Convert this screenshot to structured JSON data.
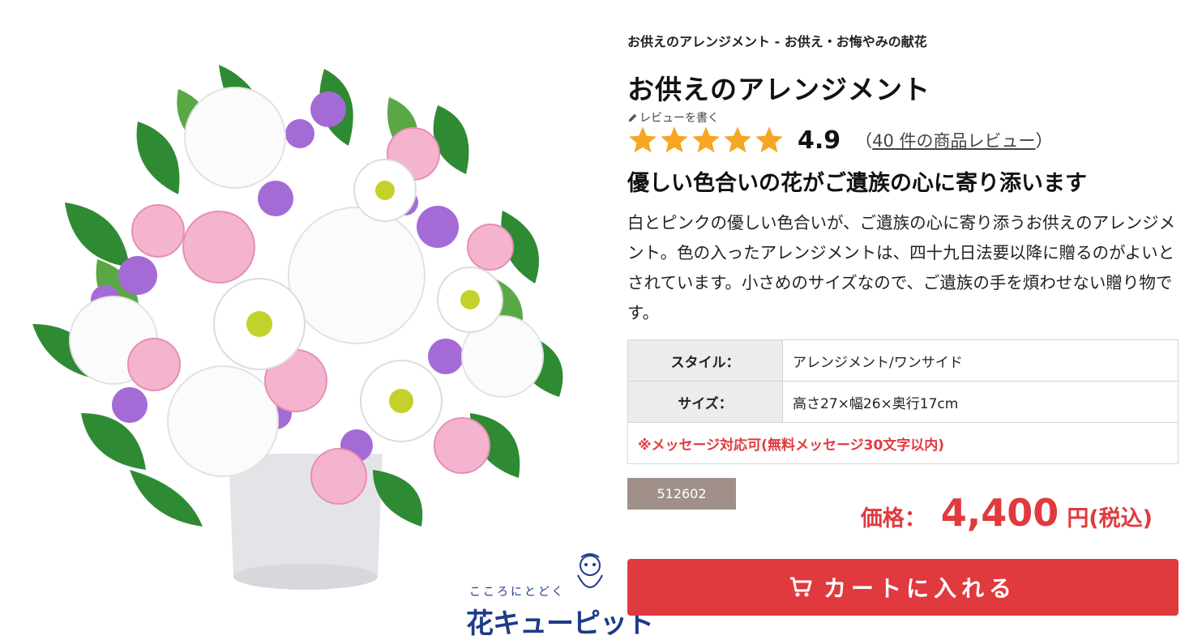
{
  "brand": {
    "tagline": "こころにとどく",
    "name": "花キューピット"
  },
  "product": {
    "breadcrumb": "お供えのアレンジメント - お供え・お悔やみの献花",
    "title": "お供えのアレンジメント",
    "write_review": "レビューを書く",
    "rating": "4.9",
    "rating_stars": 5,
    "review_open": "（",
    "review_link": "40 件の商品レビュー",
    "review_close": "）",
    "headline": "優しい色合いの花がご遺族の心に寄り添います",
    "description": "白とピンクの優しい色合いが、ご遺族の心に寄り添うお供えのアレンジメント。色の入ったアレンジメントは、四十九日法要以降に贈るのがよいとされています。小さめのサイズなので、ご遺族の手を煩わせない贈り物です。",
    "specs": [
      {
        "label": "スタイル：",
        "value": "アレンジメント/ワンサイド"
      },
      {
        "label": "サイズ：",
        "value": "高さ27×幅26×奥行17cm"
      }
    ],
    "message_note": "※メッセージ対応可(無料メッセージ30文字以内)",
    "sku": "512602",
    "price_label": "価格：",
    "price_value": "4,400",
    "price_unit": "円(税込)",
    "cart_button": "カートに入れる"
  },
  "icons": {
    "star": "star-icon",
    "pencil": "pencil-icon",
    "cart": "cart-icon"
  },
  "colors": {
    "accent_red": "#e03a3e",
    "star_gold": "#f5a623",
    "sku_badge": "#a09089",
    "brand_blue": "#1e3a8a"
  }
}
